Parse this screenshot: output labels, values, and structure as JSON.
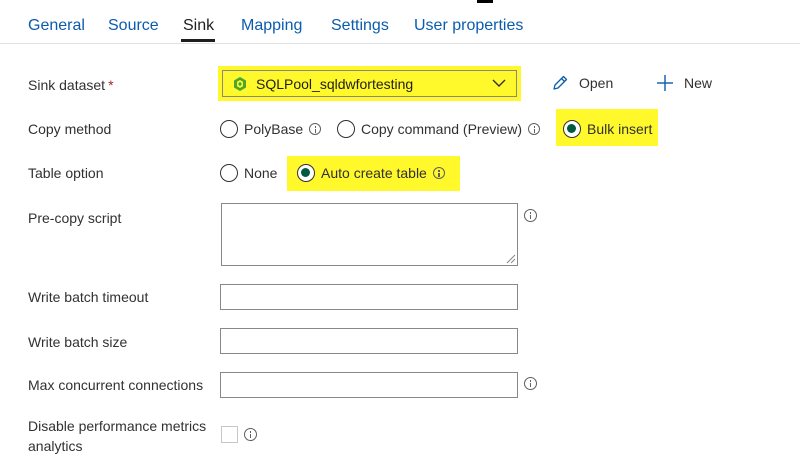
{
  "tabs": [
    {
      "label": "General"
    },
    {
      "label": "Source"
    },
    {
      "label": "Sink"
    },
    {
      "label": "Mapping"
    },
    {
      "label": "Settings"
    },
    {
      "label": "User properties"
    }
  ],
  "active_tab": "Sink",
  "sink_dataset": {
    "label": "Sink dataset",
    "required_marker": "*",
    "value": "SQLPool_sqldwfortesting",
    "icon": "sql-pool-icon",
    "open_label": "Open",
    "new_label": "New"
  },
  "copy_method": {
    "label": "Copy method",
    "options": [
      {
        "label": "PolyBase",
        "selected": false
      },
      {
        "label": "Copy command (Preview)",
        "selected": false
      },
      {
        "label": "Bulk insert",
        "selected": true
      }
    ]
  },
  "table_option": {
    "label": "Table option",
    "options": [
      {
        "label": "None",
        "selected": false
      },
      {
        "label": "Auto create table",
        "selected": true
      }
    ]
  },
  "pre_copy_script": {
    "label": "Pre-copy script",
    "value": ""
  },
  "write_batch_timeout": {
    "label": "Write batch timeout",
    "value": ""
  },
  "write_batch_size": {
    "label": "Write batch size",
    "value": ""
  },
  "max_concurrent_connections": {
    "label": "Max concurrent connections",
    "value": ""
  },
  "disable_perf_metrics": {
    "label_line1": "Disable performance metrics",
    "label_line2": "analytics",
    "checked": false
  },
  "colors": {
    "accent": "#0b5cad",
    "highlight": "#fff82b",
    "radio_selected": "#005a40",
    "required": "#a4262c"
  }
}
